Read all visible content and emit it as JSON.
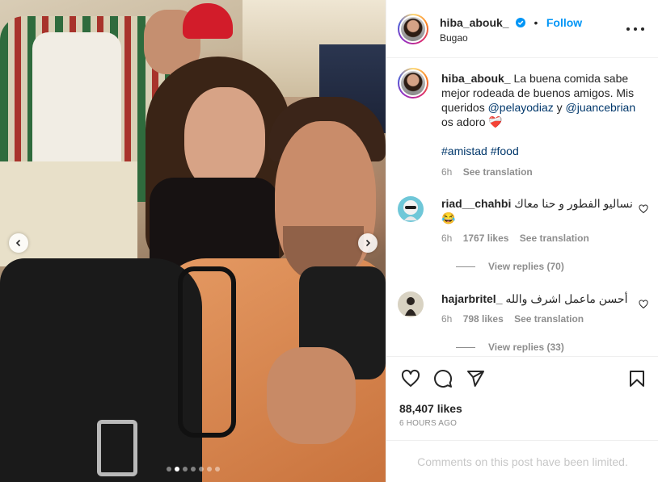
{
  "post": {
    "username": "hiba_abouk_",
    "follow_label": "Follow",
    "bullet": "•",
    "location": "Bugao",
    "caption": {
      "username": "hiba_abouk_",
      "text_1": "La buena comida sabe mejor rodeada de buenos amigos. Mis queridos",
      "mention_1": "@pelayodiaz",
      "text_2": "y",
      "mention_2": "@juancebrian",
      "text_3": "os adoro",
      "emoji": "❤️‍🩹",
      "hashtag_1": "#amistad",
      "hashtag_2": "#food",
      "time": "6h",
      "see_translation": "See translation"
    },
    "comments": [
      {
        "username": "riad__chahbi",
        "text": "نساليو الفطور و حنا معاك 😂",
        "time": "6h",
        "likes": "1767 likes",
        "see_translation": "See translation",
        "view_replies": "View replies (70)"
      },
      {
        "username": "hajarbritel_",
        "text": "أحسن ماعمل اشرف والله",
        "time": "6h",
        "likes": "798 likes",
        "see_translation": "See translation",
        "view_replies": "View replies (33)"
      }
    ],
    "likes_count": "88,407 likes",
    "time_ago": "6 HOURS AGO",
    "comments_limited": "Comments on this post have been limited.",
    "carousel": {
      "total": 7,
      "active_index": 1
    }
  },
  "colors": {
    "accent": "#0095f6",
    "link": "#00376b",
    "muted": "#8e8e8e",
    "border": "#efefef",
    "verified": "#0095f6"
  },
  "icons": [
    "verified-badge-icon",
    "more-options-icon",
    "heart-icon",
    "comment-icon",
    "share-icon",
    "bookmark-icon",
    "chevron-left-icon",
    "chevron-right-icon"
  ]
}
